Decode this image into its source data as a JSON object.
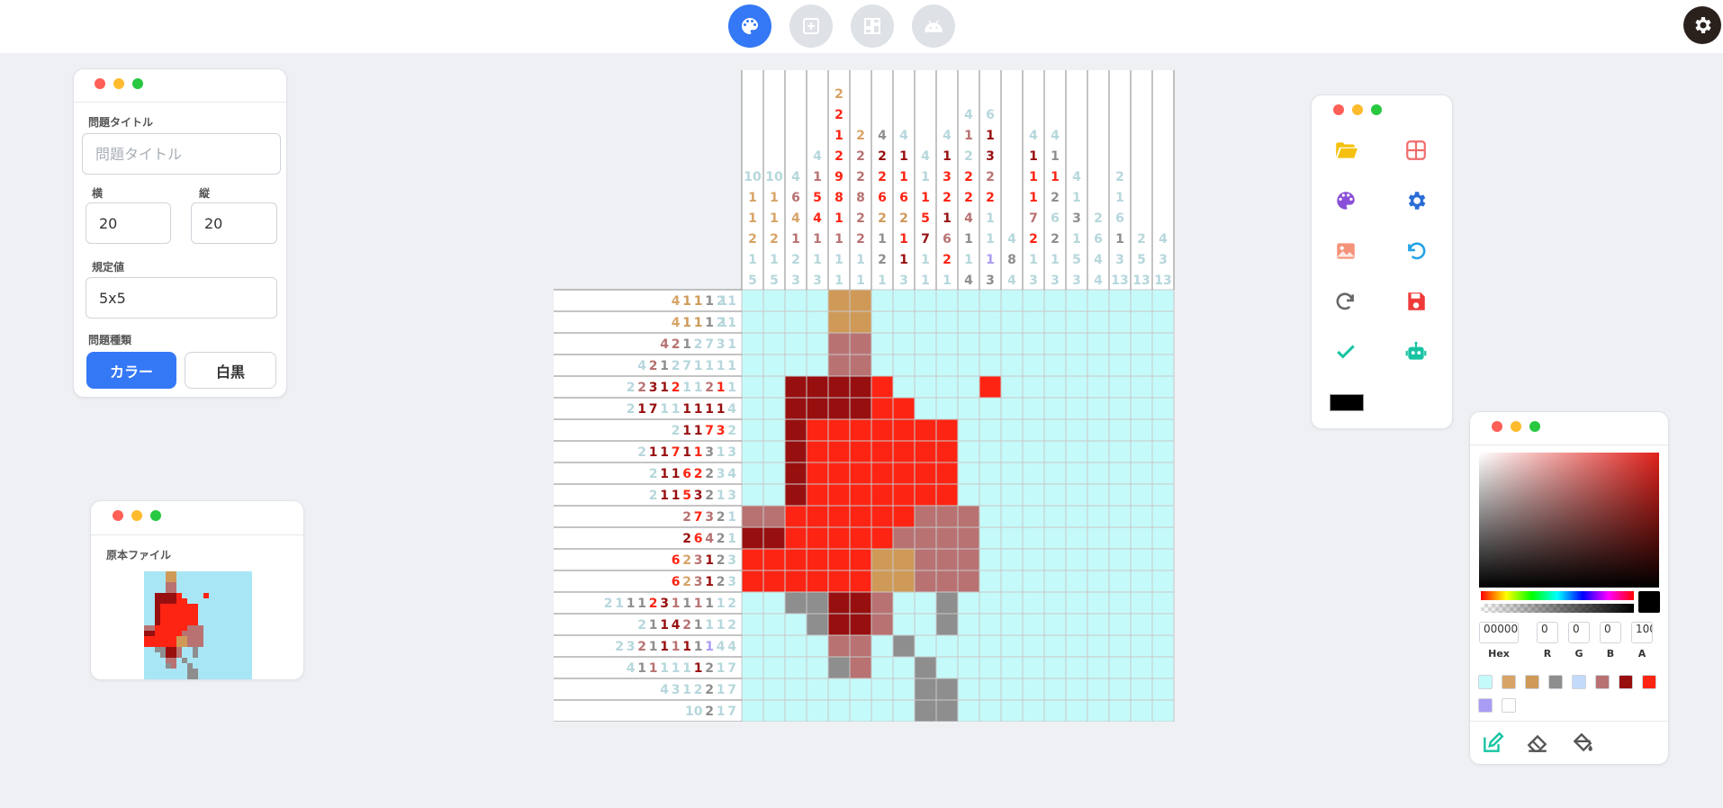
{
  "topbar": {
    "modes": [
      {
        "id": "color-mode",
        "icon": "palette-icon",
        "active": true
      },
      {
        "id": "grid-mode",
        "icon": "grid-plus-icon",
        "active": false
      },
      {
        "id": "tiles-mode",
        "icon": "tiles-icon",
        "active": false
      },
      {
        "id": "android-mode",
        "icon": "android-icon",
        "active": false
      }
    ],
    "settings_icon": "gear-icon"
  },
  "settings_panel": {
    "title_label": "問題タイトル",
    "title_placeholder": "問題タイトル",
    "title_value": "",
    "width_label": "横",
    "width_value": "20",
    "height_label": "縦",
    "height_value": "20",
    "rule_label": "規定値",
    "rule_value": "5x5",
    "type_label": "問題種類",
    "type_color": "カラー",
    "type_mono": "白黒"
  },
  "source_panel": {
    "label": "原本ファイル"
  },
  "palette": [
    "#c5fafa",
    "#d8a366",
    "#cf9a58",
    "#8e8e8e",
    "#c4dafa",
    "#b87272",
    "#980f0f",
    "#fd2414",
    "#a99cf5",
    "#ffffff"
  ],
  "puzzle": {
    "col_clues": [
      [
        [
          10,
          0
        ],
        [
          1,
          1
        ],
        [
          1,
          1
        ],
        [
          2,
          1
        ],
        [
          1,
          0
        ],
        [
          5,
          0
        ]
      ],
      [
        [
          10,
          0
        ],
        [
          1,
          1
        ],
        [
          1,
          1
        ],
        [
          2,
          1
        ],
        [
          1,
          0
        ],
        [
          5,
          0
        ]
      ],
      [
        [
          4,
          0
        ],
        [
          6,
          5
        ],
        [
          4,
          1
        ],
        [
          1,
          5
        ],
        [
          2,
          0
        ],
        [
          3,
          0
        ]
      ],
      [
        [
          4,
          0
        ],
        [
          1,
          5
        ],
        [
          5,
          7
        ],
        [
          4,
          7
        ],
        [
          1,
          5
        ],
        [
          1,
          0
        ],
        [
          3,
          0
        ]
      ],
      [
        [
          2,
          1
        ],
        [
          2,
          7
        ],
        [
          1,
          7
        ],
        [
          2,
          7
        ],
        [
          9,
          7
        ],
        [
          8,
          7
        ],
        [
          1,
          7
        ],
        [
          1,
          5
        ],
        [
          1,
          0
        ],
        [
          1,
          0
        ]
      ],
      [
        [
          2,
          1
        ],
        [
          2,
          5
        ],
        [
          2,
          5
        ],
        [
          8,
          5
        ],
        [
          2,
          5
        ],
        [
          2,
          5
        ],
        [
          1,
          0
        ],
        [
          1,
          0
        ]
      ],
      [
        [
          4,
          3
        ],
        [
          2,
          6
        ],
        [
          2,
          7
        ],
        [
          6,
          7
        ],
        [
          2,
          2
        ],
        [
          1,
          3
        ],
        [
          2,
          3
        ],
        [
          1,
          0
        ]
      ],
      [
        [
          4,
          0
        ],
        [
          1,
          6
        ],
        [
          1,
          7
        ],
        [
          6,
          7
        ],
        [
          2,
          2
        ],
        [
          1,
          7
        ],
        [
          1,
          6
        ],
        [
          3,
          0
        ]
      ],
      [
        [
          4,
          0
        ],
        [
          1,
          0
        ],
        [
          1,
          7
        ],
        [
          5,
          7
        ],
        [
          7,
          6
        ],
        [
          1,
          0
        ],
        [
          1,
          0
        ]
      ],
      [
        [
          4,
          0
        ],
        [
          1,
          6
        ],
        [
          3,
          7
        ],
        [
          2,
          7
        ],
        [
          1,
          6
        ],
        [
          6,
          5
        ],
        [
          2,
          7
        ],
        [
          1,
          0
        ]
      ],
      [
        [
          4,
          0
        ],
        [
          1,
          5
        ],
        [
          2,
          0
        ],
        [
          2,
          7
        ],
        [
          2,
          7
        ],
        [
          4,
          5
        ],
        [
          1,
          3
        ],
        [
          1,
          0
        ],
        [
          4,
          3
        ]
      ],
      [
        [
          6,
          0
        ],
        [
          1,
          6
        ],
        [
          3,
          6
        ],
        [
          2,
          5
        ],
        [
          2,
          7
        ],
        [
          1,
          0
        ],
        [
          1,
          0
        ],
        [
          1,
          8
        ],
        [
          3,
          3
        ]
      ],
      [
        [
          4,
          0
        ],
        [
          8,
          3
        ],
        [
          4,
          0
        ]
      ],
      [
        [
          4,
          0
        ],
        [
          1,
          6
        ],
        [
          1,
          7
        ],
        [
          1,
          7
        ],
        [
          7,
          5
        ],
        [
          2,
          7
        ],
        [
          1,
          0
        ],
        [
          3,
          0
        ]
      ],
      [
        [
          4,
          0
        ],
        [
          1,
          3
        ],
        [
          1,
          7
        ],
        [
          2,
          3
        ],
        [
          6,
          0
        ],
        [
          2,
          3
        ],
        [
          1,
          0
        ],
        [
          3,
          0
        ]
      ],
      [
        [
          4,
          0
        ],
        [
          1,
          0
        ],
        [
          3,
          3
        ],
        [
          1,
          0
        ],
        [
          5,
          0
        ],
        [
          3,
          0
        ]
      ],
      [
        [
          2,
          0
        ],
        [
          6,
          0
        ],
        [
          4,
          0
        ],
        [
          4,
          0
        ]
      ],
      [
        [
          2,
          0
        ],
        [
          1,
          0
        ],
        [
          6,
          0
        ],
        [
          1,
          3
        ],
        [
          3,
          0
        ],
        [
          13,
          0
        ]
      ],
      [
        [
          2,
          0
        ],
        [
          5,
          0
        ],
        [
          13,
          0
        ]
      ],
      [
        [
          4,
          0
        ],
        [
          3,
          0
        ],
        [
          13,
          0
        ]
      ]
    ],
    "row_clues": [
      [
        [
          4,
          1
        ],
        [
          1,
          2
        ],
        [
          1,
          2
        ],
        [
          1,
          3
        ],
        [
          2,
          0
        ],
        [
          11,
          0
        ]
      ],
      [
        [
          4,
          1
        ],
        [
          1,
          2
        ],
        [
          1,
          2
        ],
        [
          1,
          3
        ],
        [
          2,
          0
        ],
        [
          11,
          0
        ]
      ],
      [
        [
          4,
          5
        ],
        [
          2,
          5
        ],
        [
          1,
          3
        ],
        [
          2,
          0
        ],
        [
          7,
          0
        ],
        [
          3,
          0
        ],
        [
          1,
          0
        ]
      ],
      [
        [
          4,
          0
        ],
        [
          2,
          5
        ],
        [
          1,
          3
        ],
        [
          2,
          0
        ],
        [
          7,
          0
        ],
        [
          1,
          0
        ],
        [
          1,
          0
        ],
        [
          1,
          0
        ],
        [
          1,
          0
        ]
      ],
      [
        [
          2,
          0
        ],
        [
          2,
          5
        ],
        [
          3,
          6
        ],
        [
          1,
          6
        ],
        [
          2,
          7
        ],
        [
          1,
          0
        ],
        [
          1,
          0
        ],
        [
          2,
          5
        ],
        [
          1,
          7
        ],
        [
          1,
          0
        ]
      ],
      [
        [
          2,
          0
        ],
        [
          1,
          6
        ],
        [
          7,
          6
        ],
        [
          1,
          0
        ],
        [
          1,
          0
        ],
        [
          1,
          6
        ],
        [
          1,
          6
        ],
        [
          1,
          6
        ],
        [
          1,
          6
        ],
        [
          4,
          0
        ]
      ],
      [
        [
          2,
          0
        ],
        [
          1,
          6
        ],
        [
          1,
          6
        ],
        [
          7,
          7
        ],
        [
          3,
          7
        ],
        [
          2,
          0
        ]
      ],
      [
        [
          2,
          0
        ],
        [
          1,
          6
        ],
        [
          1,
          6
        ],
        [
          7,
          7
        ],
        [
          1,
          6
        ],
        [
          1,
          7
        ],
        [
          3,
          3
        ],
        [
          1,
          0
        ],
        [
          3,
          0
        ]
      ],
      [
        [
          2,
          0
        ],
        [
          1,
          6
        ],
        [
          1,
          6
        ],
        [
          6,
          7
        ],
        [
          2,
          7
        ],
        [
          2,
          3
        ],
        [
          3,
          0
        ],
        [
          4,
          0
        ]
      ],
      [
        [
          2,
          0
        ],
        [
          1,
          6
        ],
        [
          1,
          6
        ],
        [
          5,
          7
        ],
        [
          3,
          6
        ],
        [
          2,
          3
        ],
        [
          1,
          0
        ],
        [
          3,
          0
        ]
      ],
      [
        [
          2,
          5
        ],
        [
          7,
          7
        ],
        [
          3,
          5
        ],
        [
          2,
          3
        ],
        [
          1,
          0
        ]
      ],
      [
        [
          2,
          6
        ],
        [
          6,
          7
        ],
        [
          4,
          5
        ],
        [
          2,
          3
        ],
        [
          1,
          0
        ]
      ],
      [
        [
          6,
          7
        ],
        [
          2,
          1
        ],
        [
          3,
          5
        ],
        [
          1,
          6
        ],
        [
          2,
          3
        ],
        [
          3,
          0
        ]
      ],
      [
        [
          6,
          7
        ],
        [
          2,
          1
        ],
        [
          3,
          5
        ],
        [
          1,
          6
        ],
        [
          2,
          3
        ],
        [
          3,
          0
        ]
      ],
      [
        [
          2,
          0
        ],
        [
          1,
          0
        ],
        [
          1,
          3
        ],
        [
          1,
          3
        ],
        [
          2,
          7
        ],
        [
          3,
          6
        ],
        [
          1,
          5
        ],
        [
          1,
          3
        ],
        [
          1,
          5
        ],
        [
          1,
          3
        ],
        [
          1,
          0
        ],
        [
          2,
          0
        ]
      ],
      [
        [
          2,
          0
        ],
        [
          1,
          3
        ],
        [
          1,
          6
        ],
        [
          4,
          6
        ],
        [
          2,
          5
        ],
        [
          1,
          3
        ],
        [
          1,
          0
        ],
        [
          1,
          0
        ],
        [
          2,
          0
        ]
      ],
      [
        [
          2,
          0
        ],
        [
          3,
          0
        ],
        [
          2,
          5
        ],
        [
          1,
          3
        ],
        [
          1,
          6
        ],
        [
          1,
          5
        ],
        [
          1,
          6
        ],
        [
          1,
          3
        ],
        [
          1,
          8
        ],
        [
          4,
          0
        ],
        [
          4,
          0
        ]
      ],
      [
        [
          4,
          0
        ],
        [
          1,
          3
        ],
        [
          1,
          5
        ],
        [
          1,
          0
        ],
        [
          1,
          0
        ],
        [
          1,
          0
        ],
        [
          1,
          6
        ],
        [
          2,
          3
        ],
        [
          1,
          0
        ],
        [
          7,
          0
        ]
      ],
      [
        [
          4,
          0
        ],
        [
          3,
          0
        ],
        [
          1,
          0
        ],
        [
          2,
          0
        ],
        [
          2,
          3
        ],
        [
          1,
          0
        ],
        [
          7,
          0
        ]
      ],
      [
        [
          10,
          0
        ],
        [
          2,
          3
        ],
        [
          1,
          0
        ],
        [
          7,
          0
        ]
      ]
    ],
    "cells": [
      "000022000000000000",
      "000022000000000000",
      "000055000000000000",
      "000055000000000000",
      "006666700007000000",
      "006666770000000000",
      "006777777700000000",
      "006777777700000000",
      "006777777700000000",
      "006777777700000000",
      "557777775550000000",
      "667777755550000000",
      "777777225550000000",
      "777777225550000000",
      "003366500300000000",
      "000366500300000000",
      "000055030000000000",
      "000035003000000000",
      "000000003300000000",
      "000000003300000000"
    ]
  },
  "tools": [
    {
      "id": "open-folder",
      "icon": "folder-icon"
    },
    {
      "id": "grid",
      "icon": "grid-icon"
    },
    {
      "id": "palette",
      "icon": "palette-icon"
    },
    {
      "id": "settings",
      "icon": "gear-icon"
    },
    {
      "id": "image",
      "icon": "image-icon"
    },
    {
      "id": "undo",
      "icon": "undo-icon"
    },
    {
      "id": "redo",
      "icon": "redo-icon"
    },
    {
      "id": "save",
      "icon": "save-icon"
    },
    {
      "id": "check",
      "icon": "check-icon"
    },
    {
      "id": "robot",
      "icon": "robot-icon"
    }
  ],
  "current_color": "#000000",
  "color_picker": {
    "hex": "000000",
    "r": "0",
    "g": "0",
    "b": "0",
    "a": "100",
    "hex_label": "Hex",
    "r_label": "R",
    "g_label": "G",
    "b_label": "B",
    "a_label": "A"
  }
}
